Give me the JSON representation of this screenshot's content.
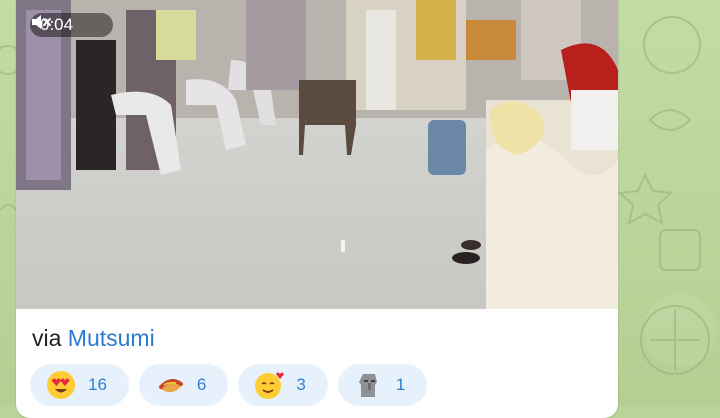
{
  "video": {
    "duration": "0:04",
    "muted": true
  },
  "message": {
    "via_prefix": "via",
    "author": "Mutsumi"
  },
  "reactions": [
    {
      "emoji": "heart-eyes-face",
      "count": "16"
    },
    {
      "emoji": "hotdog",
      "count": "6"
    },
    {
      "emoji": "smiling-face-with-hearts",
      "count": "3"
    },
    {
      "emoji": "moai",
      "count": "1"
    }
  ],
  "colors": {
    "wallpaper": "#b9d39a",
    "link": "#2b7ad2",
    "reaction_bg": "#e7f1fb",
    "reaction_text": "#2f80d1"
  }
}
